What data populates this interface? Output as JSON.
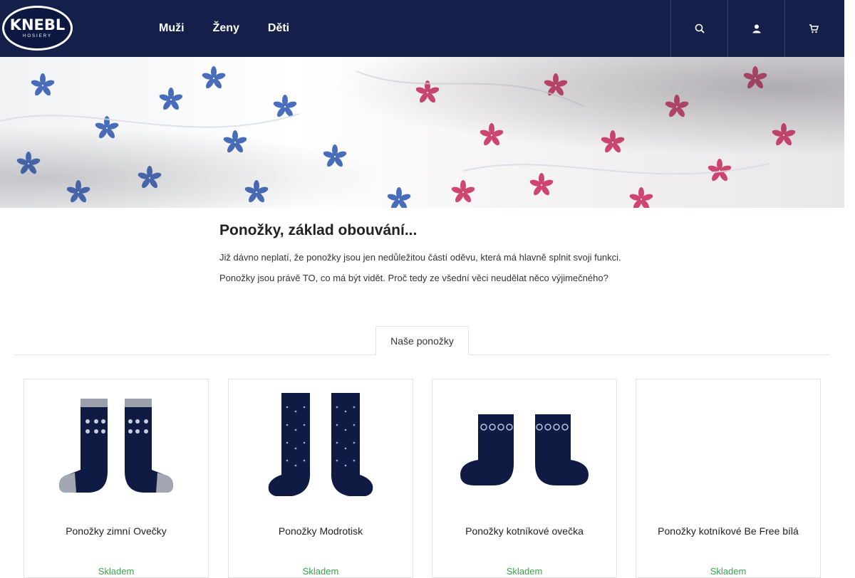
{
  "brand": {
    "logo_text": "KNEBL",
    "logo_sub": "HOSIERY"
  },
  "nav": [
    {
      "label": "Muži"
    },
    {
      "label": "Ženy"
    },
    {
      "label": "Děti"
    }
  ],
  "header_icons": [
    "search-icon",
    "user-icon",
    "cart-icon"
  ],
  "intro": {
    "title": "Ponožky, základ obouvání...",
    "paragraphs": [
      "Již dávno neplatí, že ponožky jsou jen nedůležitou částí oděvu, která má hlavně splnit svoji funkci.",
      "Ponožky jsou právě TO, co má být vidět. Proč tedy ze všední věci neudělat něco výjimečného?"
    ]
  },
  "tab": {
    "label": "Naše ponožky"
  },
  "products": [
    {
      "name": "Ponožky zimní Ovečky",
      "stock": "Skladem"
    },
    {
      "name": "Ponožky Modrotisk",
      "stock": "Skladem"
    },
    {
      "name": "Ponožky kotníkové ovečka",
      "stock": "Skladem"
    },
    {
      "name": "Ponožky kotníkové Be Free bílá",
      "stock": "Skladem"
    }
  ],
  "colors": {
    "header": "#14204a",
    "stock": "#3aa14a",
    "sock": "#101b44"
  }
}
